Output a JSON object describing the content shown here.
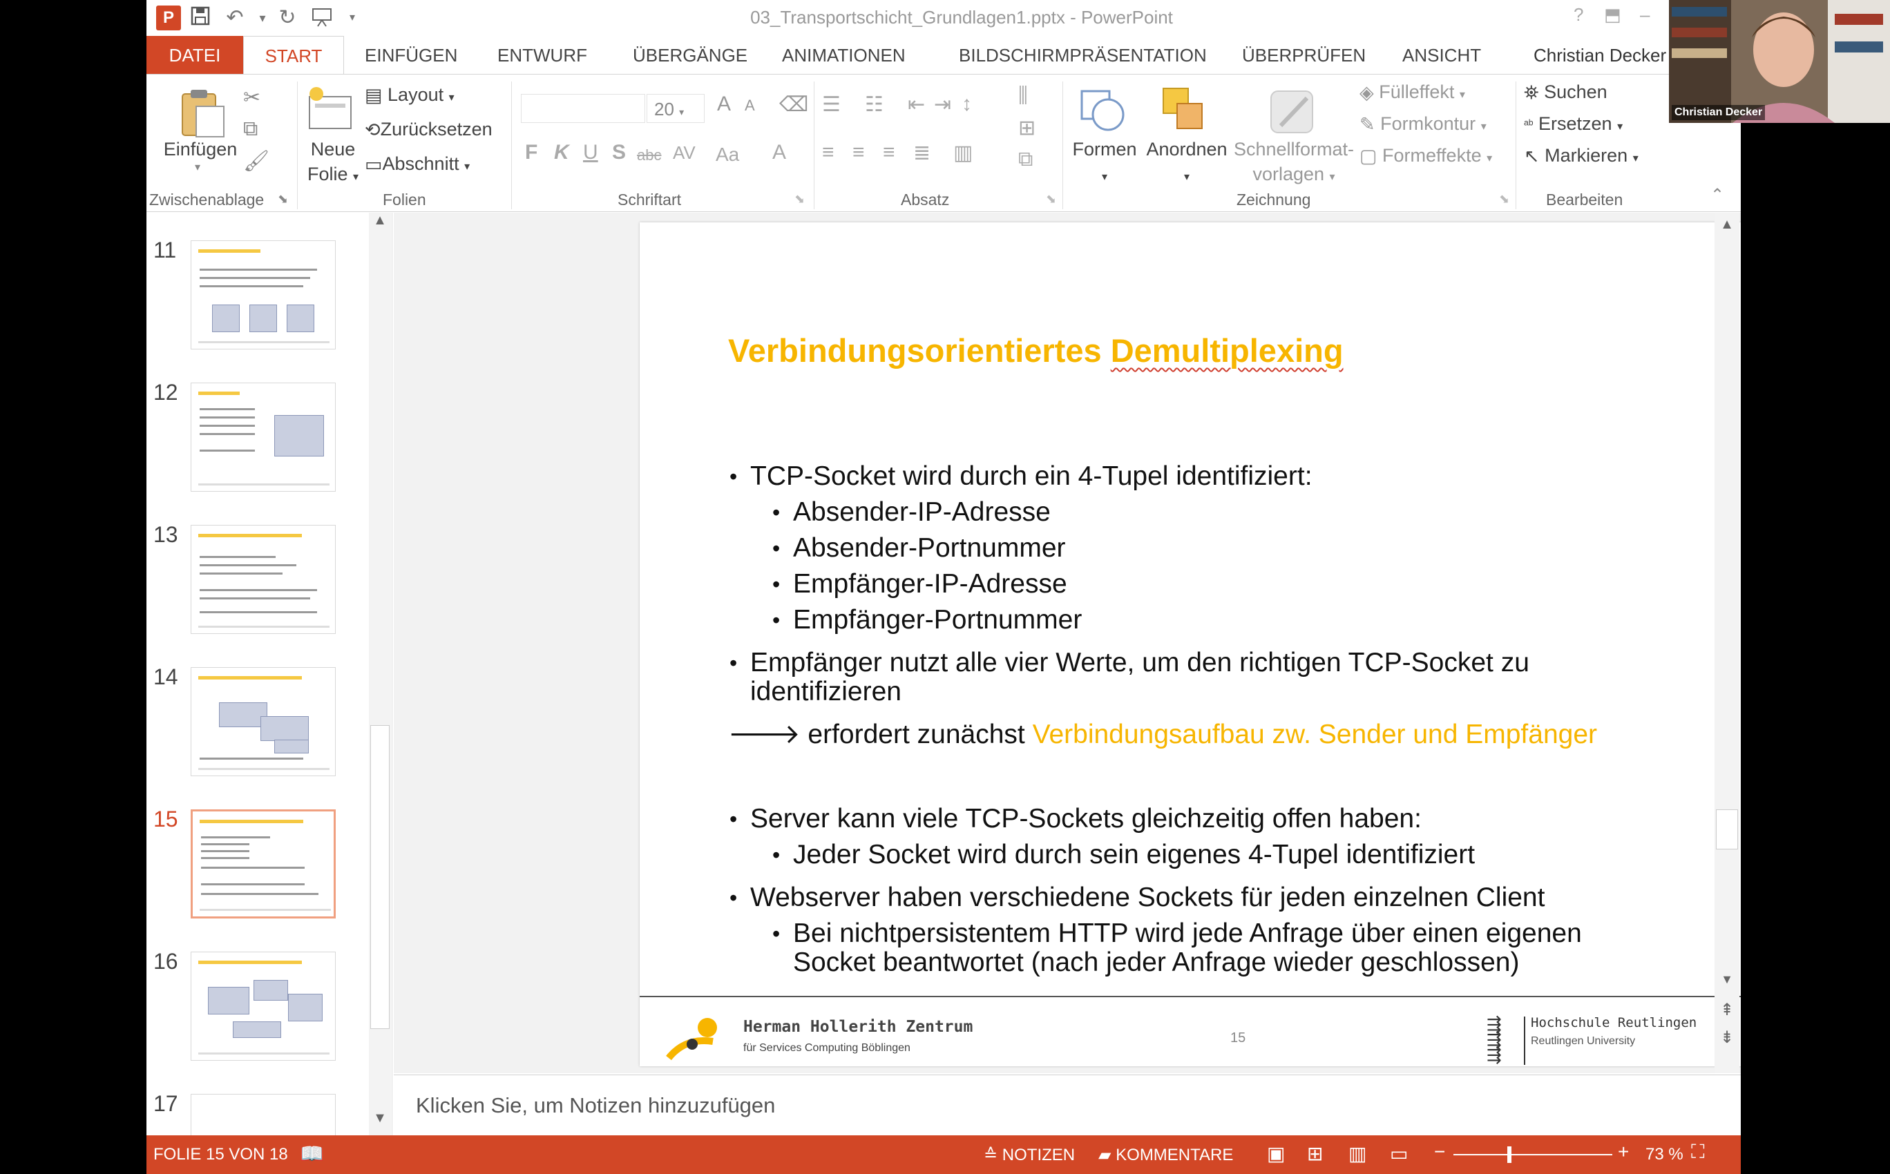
{
  "app": {
    "window_title": "03_Transportschicht_Grundlagen1.pptx - PowerPoint",
    "user": "Christian Decker",
    "logo_letter": "P",
    "help": "?"
  },
  "tabs": [
    "DATEI",
    "START",
    "EINFÜGEN",
    "ENTWURF",
    "ÜBERGÄNGE",
    "ANIMATIONEN",
    "BILDSCHIRMPRÄSENTATION",
    "ÜBERPRÜFEN",
    "ANSICHT"
  ],
  "ribbon": {
    "clipboard": {
      "paste": "Einfügen",
      "group": "Zwischenablage"
    },
    "slides": {
      "new_slide_1": "Neue",
      "new_slide_2": "Folie",
      "layout": "Layout",
      "reset": "Zurücksetzen",
      "section": "Abschnitt",
      "group": "Folien"
    },
    "font": {
      "size": "20",
      "bold": "F",
      "italic": "K",
      "underline": "U",
      "shadow": "S",
      "strike": "abc",
      "spacing": "AV",
      "case": "Aa",
      "color": "A",
      "grow": "A",
      "shrink": "A",
      "group": "Schriftart"
    },
    "paragraph": {
      "group": "Absatz"
    },
    "drawing": {
      "shapes": "Formen",
      "arrange": "Anordnen",
      "quick_styles_1": "Schnellformat-",
      "quick_styles_2": "vorlagen",
      "fill": "Fülleffekt",
      "outline": "Formkontur",
      "effects": "Formeffekte",
      "group": "Zeichnung"
    },
    "editing": {
      "find": "Suchen",
      "replace": "Ersetzen",
      "select": "Markieren",
      "group": "Bearbeiten"
    }
  },
  "thumbnails": [
    {
      "num": "11",
      "active": false
    },
    {
      "num": "12",
      "active": false
    },
    {
      "num": "13",
      "active": false
    },
    {
      "num": "14",
      "active": false
    },
    {
      "num": "15",
      "active": true
    },
    {
      "num": "16",
      "active": false
    },
    {
      "num": "17",
      "active": false
    }
  ],
  "slide": {
    "title_part1": "Verbindungsorientiertes ",
    "title_part2": "Demultiplexing",
    "bullets": {
      "b1": "TCP-Socket wird durch ein 4-Tupel identifiziert:",
      "b1_1": "Absender-IP-Adresse",
      "b1_2": "Absender-Portnummer",
      "b1_3": "Empfänger-IP-Adresse",
      "b1_4": "Empfänger-Portnummer",
      "b2_line1": "Empfänger nutzt alle vier Werte, um den richtigen TCP-Socket zu",
      "b2_line2": "identifizieren",
      "arrow_prefix": "erfordert zunächst ",
      "arrow_highlight": "Verbindungsaufbau zw. Sender und Empfänger",
      "b3": "Server kann viele TCP-Sockets gleichzeitig offen haben:",
      "b3_1": "Jeder Socket wird durch sein eigenes 4-Tupel identifiziert",
      "b4": "Webserver haben verschiedene Sockets für jeden einzelnen Client",
      "b4_1_line1": "Bei nichtpersistentem HTTP wird jede Anfrage über einen eigenen",
      "b4_1_line2": "Socket beantwortet (nach jeder Anfrage wieder geschlossen)"
    },
    "footer": {
      "left_title": "Herman Hollerith Zentrum",
      "left_sub": "für Services Computing Böblingen",
      "page": "15",
      "right_title": "Hochschule Reutlingen",
      "right_sub": "Reutlingen University"
    }
  },
  "notes_placeholder": "Klicken Sie, um Notizen hinzuzufügen",
  "status": {
    "slide_info": "FOLIE 15 VON 18",
    "notes": "NOTIZEN",
    "comments": "KOMMENTARE",
    "zoom": "73 %",
    "zoom_percent": 73
  },
  "webcam": {
    "name": "Christian Decker"
  },
  "colors": {
    "accent": "#d24726",
    "title_yellow": "#f7b500"
  }
}
